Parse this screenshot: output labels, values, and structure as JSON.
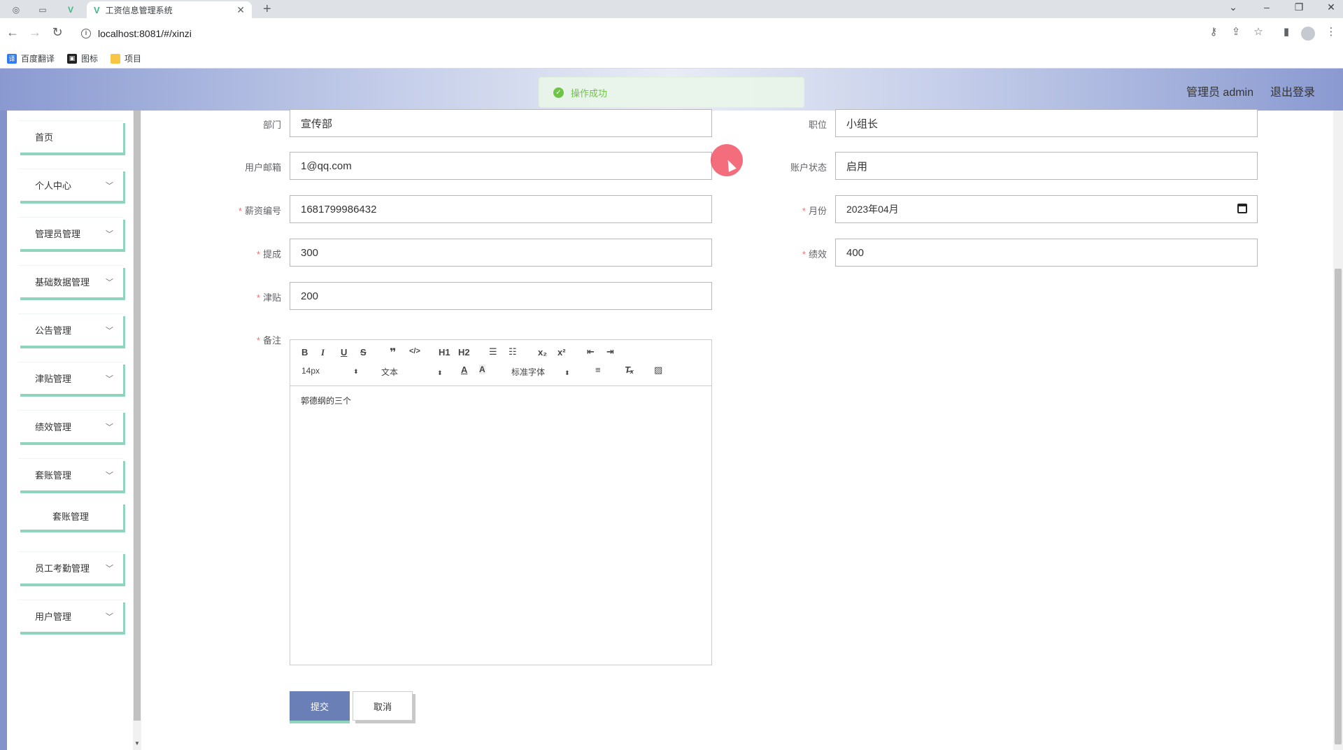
{
  "browser": {
    "tab_title": "工资信息管理系统",
    "url": "localhost:8081/#/xinzi",
    "bookmarks": [
      {
        "label": "百度翻译",
        "icon": "translate-icon",
        "color": "#2f7cf6"
      },
      {
        "label": "图标",
        "icon": "image-icon",
        "color": "#222222"
      },
      {
        "label": "项目",
        "icon": "folder-icon",
        "color": "#f6c644"
      }
    ]
  },
  "header": {
    "app_title": "工资信息管理系统",
    "user": "管理员 admin",
    "logout": "退出登录",
    "toast": "操作成功"
  },
  "sidebar": {
    "items": [
      {
        "label": "首页"
      },
      {
        "label": "个人中心"
      },
      {
        "label": "管理员管理"
      },
      {
        "label": "基础数据管理"
      },
      {
        "label": "公告管理"
      },
      {
        "label": "津贴管理"
      },
      {
        "label": "绩效管理"
      },
      {
        "label": "套账管理"
      },
      {
        "label": "员工考勤管理"
      },
      {
        "label": "用户管理"
      }
    ],
    "submenu": {
      "label": "套账管理"
    }
  },
  "form": {
    "department": {
      "label": "部门",
      "value": "宣传部"
    },
    "position": {
      "label": "职位",
      "value": "小组长"
    },
    "email": {
      "label": "用户邮箱",
      "value": "1@qq.com"
    },
    "account_status": {
      "label": "账户状态",
      "value": "启用"
    },
    "salary_no": {
      "label": "薪资编号",
      "value": "1681799986432"
    },
    "month": {
      "label": "月份",
      "value": "2023年04月"
    },
    "commission": {
      "label": "提成",
      "value": "300"
    },
    "performance": {
      "label": "绩效",
      "value": "400"
    },
    "allowance": {
      "label": "津贴",
      "value": "200"
    },
    "remark": {
      "label": "备注",
      "value": "郭德纲的三个"
    },
    "required_mark": "*"
  },
  "editor_toolbar": {
    "font_size": "14px",
    "block": "文本",
    "font_family": "标准字体",
    "h1": "H1",
    "h2": "H2"
  },
  "actions": {
    "submit": "提交",
    "cancel": "取消"
  },
  "colors": {
    "accent": "#6a7fb5",
    "menu_shadow": "#8fd4bd",
    "success": "#67c23a",
    "required": "#f56c6c"
  }
}
